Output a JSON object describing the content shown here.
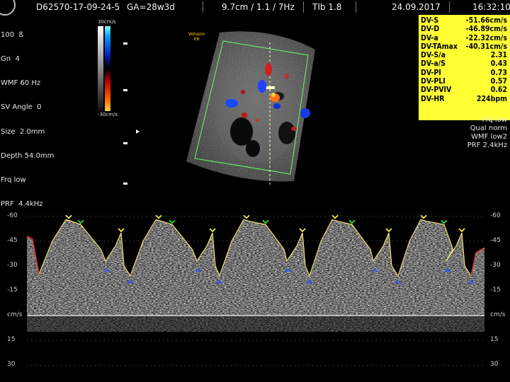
{
  "header": {
    "patient_id": "D62570-17-09-24-5",
    "ga": "GA=28w3d",
    "probe_info": "9.7cm / 1.1 / 7Hz",
    "tib": "TIb  1.8",
    "date": "24.09.2017",
    "time": "16:32:10"
  },
  "left_params": [
    "100  ß",
    "Gn  4",
    "WMF 60 Hz",
    "SV Angle  0",
    "Size  2.0mm",
    "Depth 54.0mm",
    "Frq low",
    "PRF  4.4kHz"
  ],
  "color_bar": {
    "top_label": "30cm/s",
    "bottom_label": "-30cm/s"
  },
  "logo": {
    "line1": "Voluson",
    "line2": "E6"
  },
  "measurements": [
    {
      "label": "DV-S",
      "value": "-51.66cm/s"
    },
    {
      "label": "DV-D",
      "value": "-46.89cm/s"
    },
    {
      "label": "DV-a",
      "value": "-22.32cm/s"
    },
    {
      "label": "DV-TAmax",
      "value": "-40.31cm/s"
    },
    {
      "label": "DV-S/a",
      "value": "2.31"
    },
    {
      "label": "DV-a/S",
      "value": "0.43"
    },
    {
      "label": "DV-PI",
      "value": "0.73"
    },
    {
      "label": "DV-PLI",
      "value": "0.57"
    },
    {
      "label": "DV-PVIV",
      "value": "0.62"
    },
    {
      "label": "DV-HR",
      "value": "224bpm"
    }
  ],
  "right_params": [
    "Frq low",
    "Qual norm",
    "WMF low2",
    "PRF  2.4kHz"
  ],
  "doppler": {
    "axis_left": [
      "-60",
      "-45",
      "-30",
      "-15",
      "cm/s",
      "15",
      "30"
    ],
    "axis_right": [
      "-60",
      "-45",
      "-30",
      "-15",
      "cm/s",
      "15",
      "30"
    ],
    "axis_values": [
      -60,
      -45,
      -30,
      -15,
      0,
      15,
      30
    ],
    "scale_min": -65,
    "scale_max": 35
  },
  "colors": {
    "measure_bg": "#ffff33",
    "trace": "#f0e070",
    "marker_green": "#33dd33",
    "marker_yellow": "#f0f040",
    "marker_blue": "#3050ff",
    "fov_outline": "#66ff66"
  }
}
